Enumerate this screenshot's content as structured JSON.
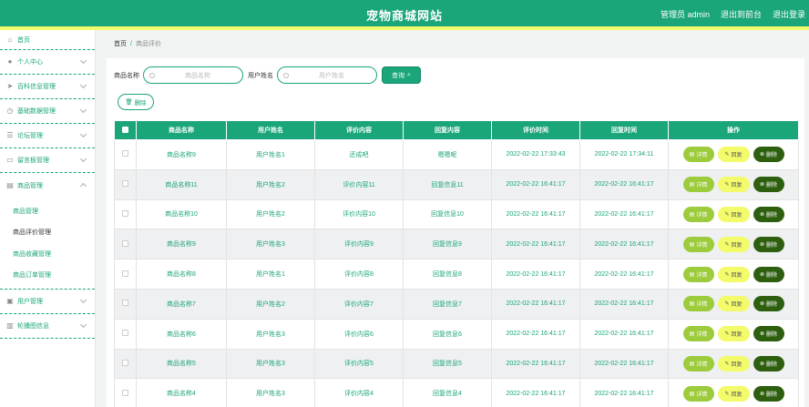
{
  "header": {
    "title": "宠物商城网站",
    "nav": [
      "管理员 admin",
      "退出到前台",
      "退出登录"
    ]
  },
  "sidebar": {
    "items": [
      {
        "label": "首页",
        "icon": "home-icon",
        "glyph": "⌂"
      },
      {
        "label": "个人中心",
        "icon": "user-icon",
        "glyph": "●"
      },
      {
        "label": "百科信息管理",
        "icon": "send-icon",
        "glyph": "➤"
      },
      {
        "label": "基础数据管理",
        "icon": "clock-icon",
        "glyph": "◷"
      },
      {
        "label": "论坛管理",
        "icon": "sliders-icon",
        "glyph": "☰"
      },
      {
        "label": "留言板管理",
        "icon": "message-icon",
        "glyph": "▭"
      },
      {
        "label": "商品管理",
        "icon": "box-icon",
        "glyph": "▤"
      },
      {
        "label": "用户管理",
        "icon": "users-icon",
        "glyph": "▣"
      },
      {
        "label": "轮播图信息",
        "icon": "trash-icon",
        "glyph": "▥"
      }
    ],
    "submenu": [
      "商品管理",
      "商品评价管理",
      "商品收藏管理",
      "商品订单管理"
    ]
  },
  "breadcrumb": {
    "home": "首页",
    "separator": "/",
    "current": "商品评价"
  },
  "search": {
    "product_label": "商品名称",
    "product_placeholder": "商品名称",
    "user_label": "用户姓名",
    "user_placeholder": "用户姓名",
    "query_label": "查询"
  },
  "actions": {
    "delete_label": "删除"
  },
  "table": {
    "columns": [
      "商品名称",
      "用户姓名",
      "评价内容",
      "回复内容",
      "评价时间",
      "回复时间",
      "操作"
    ],
    "op_labels": {
      "detail": "详情",
      "reply": "回复",
      "delete": "删除"
    },
    "rows": [
      [
        "商品名称9",
        "用户姓名1",
        "还成吧",
        "嗯嗯呢",
        "2022-02-22 17:33:43",
        "2022-02-22 17:34:11"
      ],
      [
        "商品名称11",
        "用户姓名2",
        "评价内容11",
        "回复信息11",
        "2022-02-22 16:41:17",
        "2022-02-22 16:41:17"
      ],
      [
        "商品名称10",
        "用户姓名2",
        "评价内容10",
        "回复信息10",
        "2022-02-22 16:41:17",
        "2022-02-22 16:41:17"
      ],
      [
        "商品名称9",
        "用户姓名3",
        "评价内容9",
        "回复信息9",
        "2022-02-22 16:41:17",
        "2022-02-22 16:41:17"
      ],
      [
        "商品名称8",
        "用户姓名1",
        "评价内容8",
        "回复信息8",
        "2022-02-22 16:41:17",
        "2022-02-22 16:41:17"
      ],
      [
        "商品名称7",
        "用户姓名2",
        "评价内容7",
        "回复信息7",
        "2022-02-22 16:41:17",
        "2022-02-22 16:41:17"
      ],
      [
        "商品名称6",
        "用户姓名3",
        "评价内容6",
        "回复信息6",
        "2022-02-22 16:41:17",
        "2022-02-22 16:41:17"
      ],
      [
        "商品名称5",
        "用户姓名3",
        "评价内容5",
        "回复信息5",
        "2022-02-22 16:41:17",
        "2022-02-22 16:41:17"
      ],
      [
        "商品名称4",
        "用户姓名3",
        "评价内容4",
        "回复信息4",
        "2022-02-22 16:41:17",
        "2022-02-22 16:41:17"
      ]
    ]
  },
  "colors": {
    "primary": "#1aa57a",
    "accent_yellow": "#f3fb6a",
    "detail_green": "#9ccb3c",
    "delete_dark": "#2d5f0f"
  }
}
